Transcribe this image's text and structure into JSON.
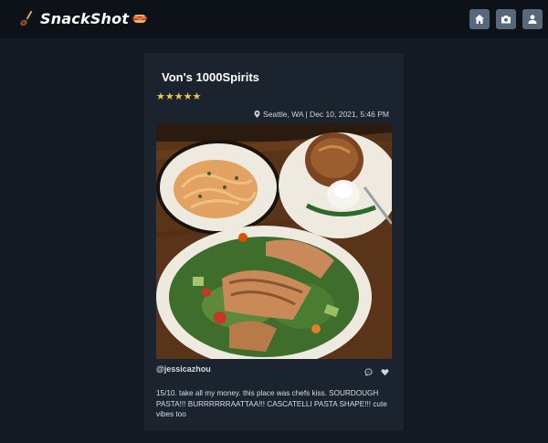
{
  "app": {
    "name": "SnackShot",
    "nav": [
      "home-icon",
      "camera-icon",
      "user-icon"
    ]
  },
  "post": {
    "place": "Von's 1000Spirits",
    "rating": 5,
    "stars": "★★★★★",
    "location_datetime": "Seattle, WA | Dec 10, 2021, 5:46 PM",
    "username": "@jessicazhou",
    "caption": "15/10. take all my money. this place was chefs kiss. SOURDOUGH PASTA!!! BURRRRRRAATTAA!!! CASCATELLI PASTA SHAPE!!! cute vibes too"
  },
  "colors": {
    "background": "#131a23",
    "topbar": "#0d1218",
    "card": "#1a232e",
    "nav_button": "#56687a",
    "star": "#f4c542"
  }
}
